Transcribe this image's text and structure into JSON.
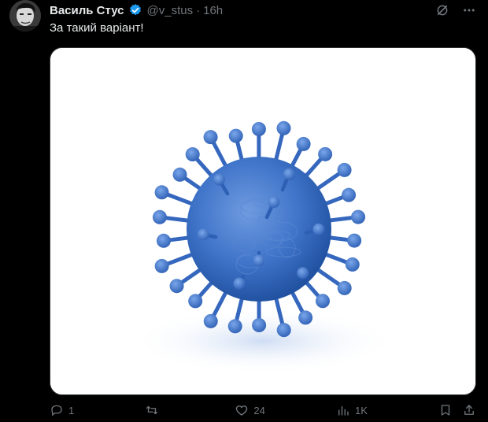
{
  "author": {
    "display_name": "Василь Стус",
    "handle": "@v_stus",
    "separator": "·",
    "time": "16h",
    "verified": true
  },
  "tweet": {
    "text": "За такий варіант!"
  },
  "media": {
    "subject": "blue-virus-illustration"
  },
  "actions": {
    "replies": "1",
    "reposts": "",
    "likes": "24",
    "views": "1K"
  },
  "icons": {
    "grok": "grok-icon",
    "more": "more-icon",
    "reply": "reply-icon",
    "repost": "repost-icon",
    "like": "heart-icon",
    "views": "views-icon",
    "bookmark": "bookmark-icon",
    "share": "share-icon"
  },
  "colors": {
    "background": "#000000",
    "text": "#e7e9ea",
    "muted": "#71767b",
    "verified": "#1d9bf0",
    "virus": "#3f74c9"
  }
}
